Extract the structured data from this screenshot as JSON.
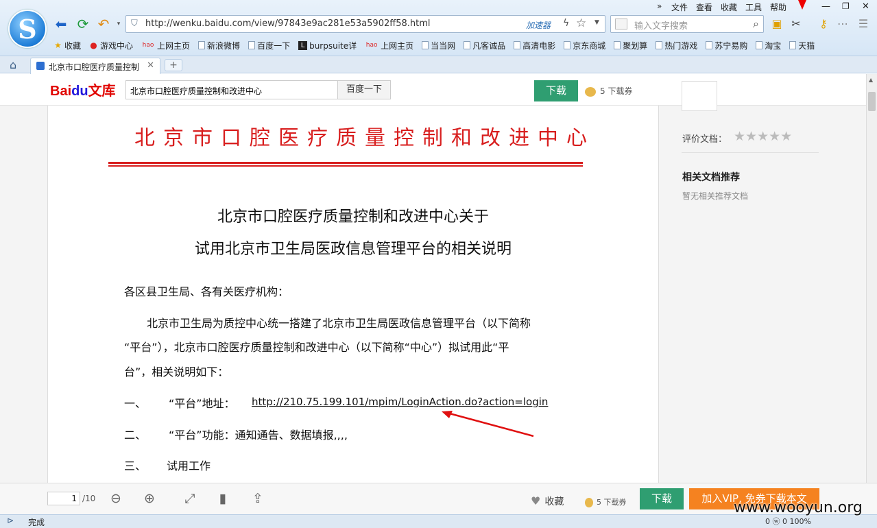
{
  "menu": {
    "items": [
      "文件",
      "查看",
      "收藏",
      "工具",
      "帮助"
    ]
  },
  "address": {
    "url": "http://wenku.baidu.com/view/97843e9ac281e53a5902ff58.html",
    "accelerator": "加速器"
  },
  "search": {
    "placeholder": "输入文字搜索"
  },
  "bookmarks": [
    {
      "label": "收藏",
      "icon": "star-icon"
    },
    {
      "label": "游戏中心",
      "icon": "game-icon"
    },
    {
      "label": "上网主页",
      "icon": "hao-icon"
    },
    {
      "label": "新浪微博",
      "icon": "page-icon"
    },
    {
      "label": "百度一下",
      "icon": "page-icon"
    },
    {
      "label": "burpsuite详",
      "icon": "l-icon"
    },
    {
      "label": "上网主页",
      "icon": "hao-icon"
    },
    {
      "label": "当当网",
      "icon": "page-icon"
    },
    {
      "label": "凡客诚品",
      "icon": "page-icon"
    },
    {
      "label": "高清电影",
      "icon": "page-icon"
    },
    {
      "label": "京东商城",
      "icon": "page-icon"
    },
    {
      "label": "聚划算",
      "icon": "page-icon"
    },
    {
      "label": "热门游戏",
      "icon": "page-icon"
    },
    {
      "label": "苏宁易购",
      "icon": "page-icon"
    },
    {
      "label": "淘宝",
      "icon": "page-icon"
    },
    {
      "label": "天猫",
      "icon": "page-icon"
    }
  ],
  "tab": {
    "title": "北京市口腔医疗质量控制"
  },
  "wenku": {
    "logo_red": "Bai",
    "logo_blue": "du",
    "logo_suffix": "文库",
    "search_value": "北京市口腔医疗质量控制和改进中心",
    "search_button": "百度一下",
    "download": "下载",
    "coins": "5  下载券"
  },
  "doc": {
    "org_header": "北京市口腔医疗质量控制和改进中心",
    "title_line1": "北京市口腔医疗质量控制和改进中心关于",
    "title_line2": "试用北京市卫生局医政信息管理平台的相关说明",
    "salutation": "各区县卫生局、各有关医疗机构：",
    "body_line1": "北京市卫生局为质控中心统一搭建了北京市卫生局医政信息管理平台（以下简称",
    "body_line2": "“平台”），北京市口腔医疗质量控制和改进中心（以下简称“中心”）拟试用此“平",
    "body_line3": "台”，相关说明如下：",
    "item1_num": "一、",
    "item1_label": "“平台”地址：",
    "item1_link": "http://210.75.199.101/mpim/LoginAction.do?action=login",
    "item2_num": "二、",
    "item2_text": "“平台”功能：通知通告、数据填报,,,,",
    "item3_num": "三、",
    "item3_text": "试用工作"
  },
  "sidebar": {
    "rate_label": "评价文档：",
    "rating": 0,
    "related_heading": "相关文档推荐",
    "related_none": "暂无相关推荐文档"
  },
  "toolbar": {
    "page_current": "1",
    "page_total": "/10",
    "favorite": "收藏",
    "coins": "5  下载券",
    "download": "下载",
    "vip": "加入VIP, 免券下载本文"
  },
  "status": {
    "text": "完成",
    "right": "0  ⓦ 0   100%"
  },
  "watermark": "www.wooyun.org"
}
